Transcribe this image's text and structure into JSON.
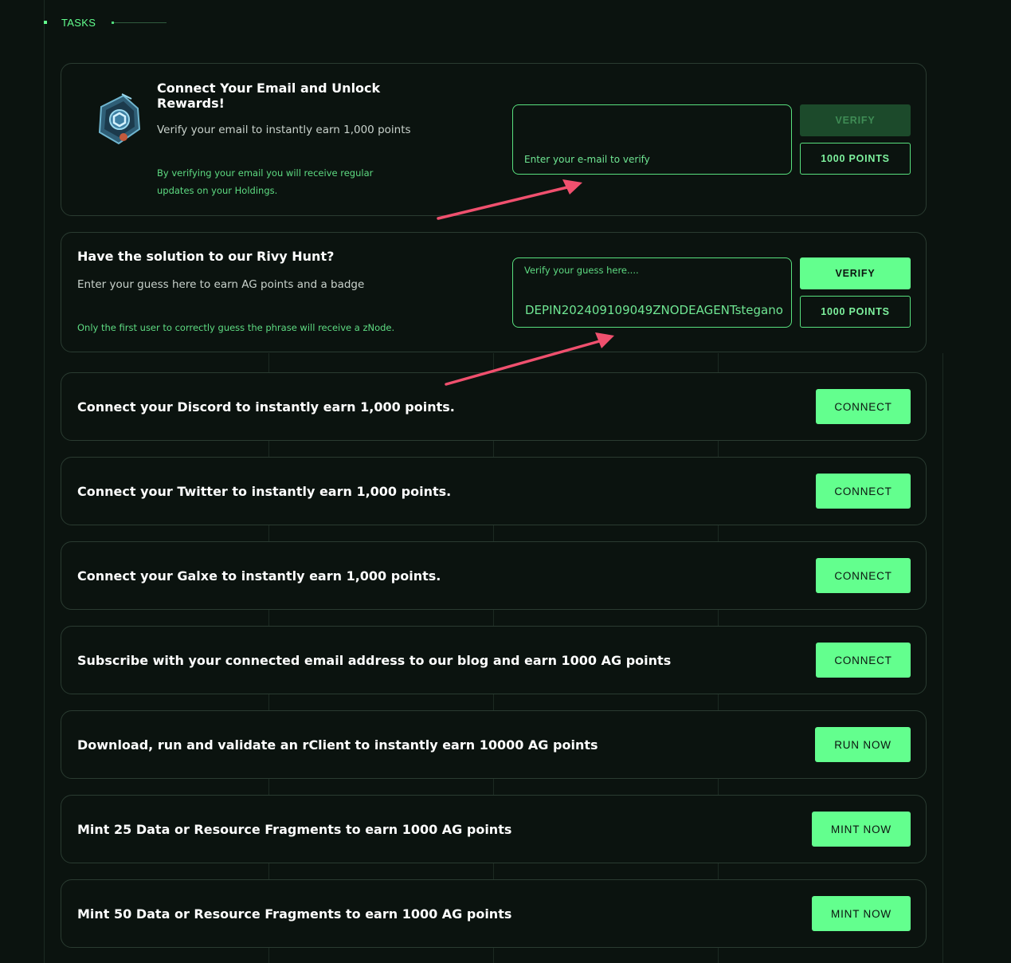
{
  "header": {
    "title": "TASKS"
  },
  "email_task": {
    "title": "Connect Your Email and Unlock Rewards!",
    "subtitle": "Verify your email to instantly earn 1,000 points",
    "note": "By verifying your email you will receive regular updates on your Holdings.",
    "placeholder": "Enter your e-mail to verify",
    "verify_label": "VERIFY",
    "points_label": "1000 POINTS"
  },
  "hunt_task": {
    "title": "Have the solution to our Rivy Hunt?",
    "subtitle": "Enter your guess here to earn AG points and a badge",
    "note": "Only the first user to correctly guess the phrase will receive a zNode.",
    "placeholder": "Verify your guess here....",
    "value": "DEPIN202409109049ZNODEAGENTstegano",
    "verify_label": "VERIFY",
    "points_label": "1000 POINTS"
  },
  "tasks": [
    {
      "title": "Connect your Discord to instantly earn 1,000 points.",
      "button": "CONNECT"
    },
    {
      "title": "Connect your Twitter to instantly earn 1,000 points.",
      "button": "CONNECT"
    },
    {
      "title": "Connect your Galxe to instantly earn 1,000 points.",
      "button": "CONNECT"
    },
    {
      "title": "Subscribe with your connected email address to our blog and earn 1000 AG points",
      "button": "CONNECT"
    },
    {
      "title": "Download, run and validate an rClient to instantly earn 10000 AG points",
      "button": "RUN NOW"
    },
    {
      "title": "Mint 25 Data or Resource Fragments to earn 1000 AG points",
      "button": "MINT NOW"
    },
    {
      "title": "Mint 50 Data or Resource Fragments to earn 1000 AG points",
      "button": "MINT NOW"
    }
  ],
  "colors": {
    "accent": "#63ff8e",
    "background": "#0b130f",
    "annotation_arrow": "#f0506e"
  }
}
